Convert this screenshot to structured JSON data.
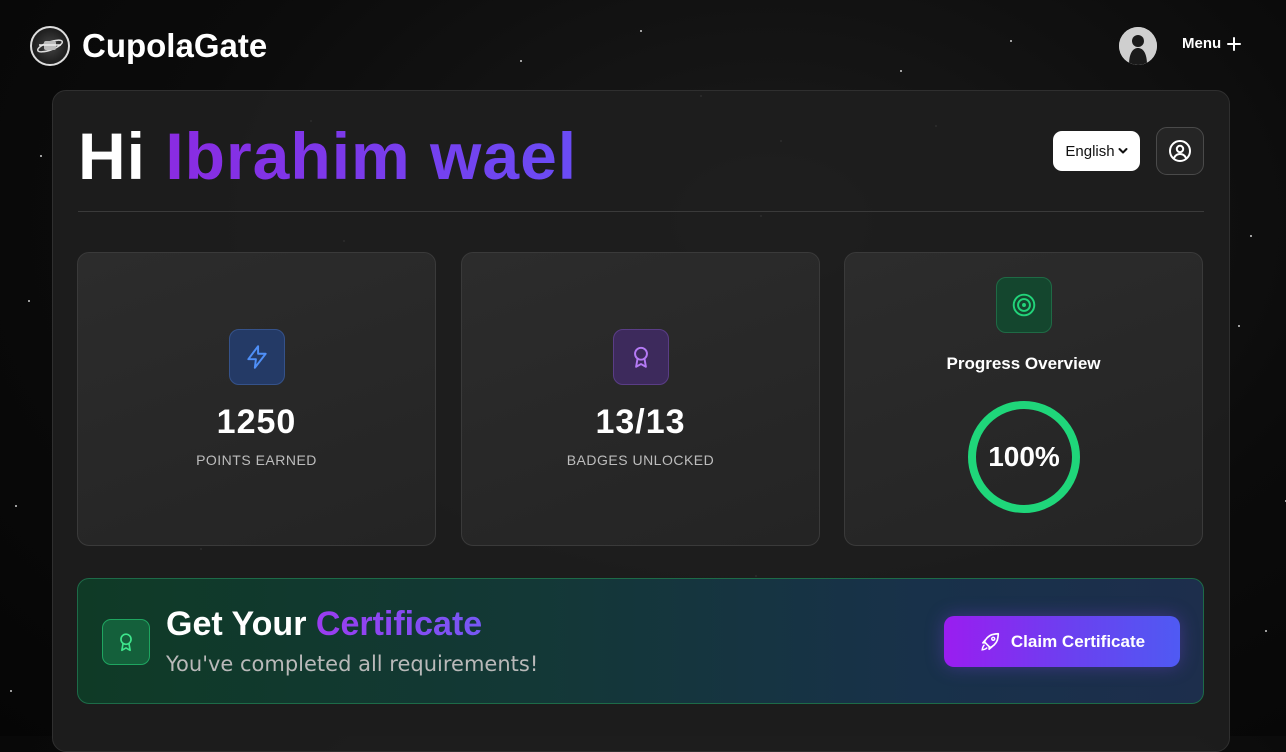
{
  "app": {
    "name": "CupolaGate"
  },
  "topbar": {
    "menu_label": "Menu"
  },
  "greeting": {
    "prefix": "Hi",
    "name": "Ibrahim wael"
  },
  "language": {
    "selected": "English"
  },
  "stats": [
    {
      "value": "1250",
      "label": "POINTS EARNED",
      "icon": "lightning-icon",
      "color": "#3b82f6"
    },
    {
      "value": "13/13",
      "label": "BADGES UNLOCKED",
      "icon": "award-icon",
      "color": "#a855f7"
    }
  ],
  "progress": {
    "title": "Progress Overview",
    "percent_text": "100%",
    "percent": 100,
    "icon": "target-icon",
    "color": "#1fd67a"
  },
  "certificate": {
    "title_plain": "Get Your",
    "title_accent": "Certificate",
    "subtitle": "You've completed all requirements!",
    "button_label": "Claim Certificate",
    "icon": "award-icon"
  }
}
